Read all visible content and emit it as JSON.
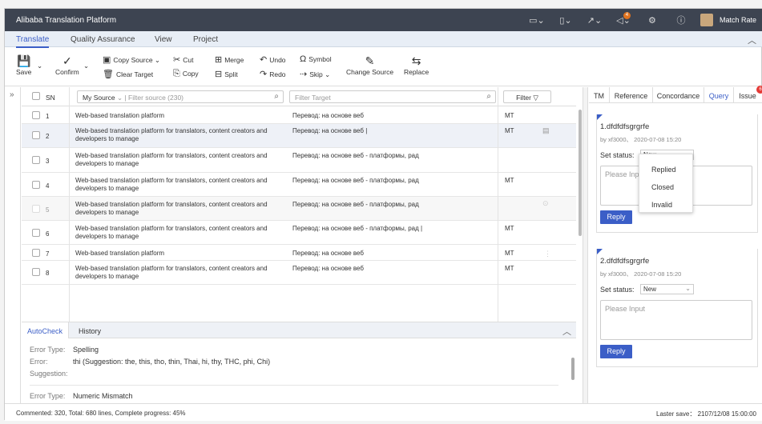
{
  "app": {
    "title": "Alibaba Translation Platform",
    "user": "Match Rate",
    "notif_count": "4"
  },
  "menu": {
    "tabs": [
      "Translate",
      "Quality Assurance",
      "View",
      "Project"
    ]
  },
  "toolbar": {
    "save": "Save",
    "confirm": "Confirm",
    "copy_source": "Copy Source",
    "clear_target": "Clear Target",
    "cut": "Cut",
    "copy": "Copy",
    "merge": "Merge",
    "split": "Split",
    "undo": "Undo",
    "redo": "Redo",
    "symbol": "Symbol",
    "skip": "Skip",
    "change_source": "Change Source",
    "replace": "Replace"
  },
  "grid": {
    "sn_header": "SN",
    "source_select": "My Source",
    "filter_source_placeholder": "Filter source (230)",
    "filter_target_placeholder": "Filter Target",
    "filter_button": "Filter",
    "rows": [
      {
        "sn": "1",
        "source": "Web-based translation platform",
        "target": "Перевод: на основе веб",
        "mt": "MT"
      },
      {
        "sn": "2",
        "source": "Web-based translation platform for translators, content creators and developers to manage",
        "target": "Перевод: на основе веб |",
        "mt": "MT"
      },
      {
        "sn": "3",
        "source": "Web-based translation platform for translators, content creators and developers to manage",
        "target": "Перевод: на основе веб - платформы, рад",
        "mt": ""
      },
      {
        "sn": "4",
        "source": "Web-based translation platform for translators, content creators and developers to manage",
        "target": "Перевод: на основе веб - платформы, рад",
        "mt": "MT"
      },
      {
        "sn": "5",
        "source": "Web-based translation platform for translators, content creators and developers to manage",
        "target": "Перевод: на основе веб - платформы, рад",
        "mt": ""
      },
      {
        "sn": "6",
        "source": "Web-based translation platform for translators, content creators and developers to manage",
        "target": "Перевод: на основе веб - платформы, рад |",
        "mt": "MT"
      },
      {
        "sn": "7",
        "source": "Web-based translation platform",
        "target": "Перевод: на основе веб",
        "mt": "MT"
      },
      {
        "sn": "8",
        "source": "Web-based translation platform for translators, content creators and developers to manage",
        "target": "Перевод: на основе веб",
        "mt": "MT"
      }
    ]
  },
  "bottom": {
    "tabs": [
      "AutoCheck",
      "History"
    ],
    "error_type_label": "Error Type:",
    "error_label": "Error:",
    "suggestion_label": "Suggestion:",
    "error1_type": "Spelling",
    "error1_text": "thi (Suggestion: the, this, tho, thin, Thai, hi, thy, THC, phi, Chi)",
    "error2_type": "Numeric Mismatch"
  },
  "right_panel": {
    "tabs": [
      "TM",
      "Reference",
      "Concordance",
      "Query",
      "Issue"
    ],
    "issue_count": "6",
    "set_status_label": "Set status:",
    "reply_label": "Reply",
    "placeholder": "Please Input",
    "queries": [
      {
        "title": "1.dfdfdfsgrgrfe",
        "meta": "by xf3000、 2020-07-08 15:20",
        "status": "New"
      },
      {
        "title": "2.dfdfdfsgrgrfe",
        "meta": "by xf3000、 2020-07-08 15:20",
        "status": "New"
      }
    ],
    "dropdown_options": [
      "Replied",
      "Closed",
      "Invalid"
    ]
  },
  "status": {
    "left": "Commented: 320, Total: 680 lines, Complete progress: 45%",
    "right": "Laster save： 2107/12/08 15:00:00"
  }
}
